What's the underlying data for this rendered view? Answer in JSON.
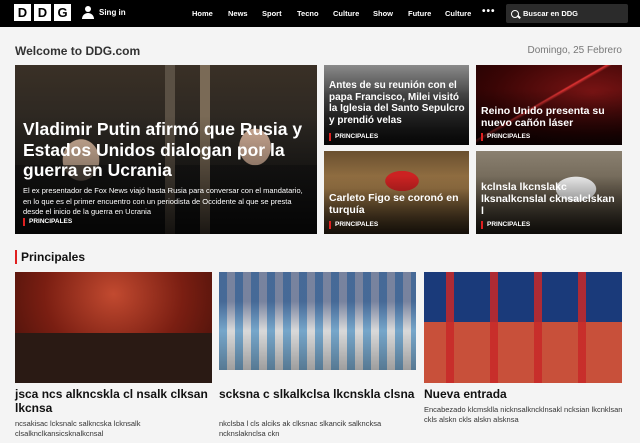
{
  "topbar": {
    "logo_letters": [
      "D",
      "D",
      "G"
    ],
    "signin_label": "Sing in",
    "nav": [
      "Home",
      "News",
      "Sport",
      "Tecno",
      "Culture",
      "Show",
      "Future",
      "Culture"
    ],
    "more_label": "•••",
    "search_placeholder": "Buscar en DDG"
  },
  "header": {
    "welcome": "Welcome to DDG.com",
    "date": "Domingo, 25 Febrero"
  },
  "hero": {
    "title": "Vladimir Putin afirmó que Rusia y Estados Unidos dialogan por la guerra en Ucrania",
    "description": "El ex presentador de Fox News viajó hasta Rusia para conversar con el mandatario, en lo que es el primer encuentro con un periodista de Occidente al que se presta desde el inicio de la guerra en Ucrania",
    "tag": "PRINCIPALES"
  },
  "tiles": [
    {
      "title": "Antes de su reunión con el papa Francisco, Milei visitó la Iglesia del Santo Sepulcro y prendió velas",
      "tag": "PRINCIPALES"
    },
    {
      "title": "Reino Unido presenta su nuevo cañón láser",
      "tag": "PRINCIPALES"
    },
    {
      "title": "Carleto Figo se coronó en turquía",
      "tag": "PRINCIPALES"
    },
    {
      "title": "kclnsla lkcnslakc lksnalkcnslal cknsalclskan l",
      "tag": "PRINCIPALES"
    }
  ],
  "principales": {
    "section_title": "Principales",
    "articles": [
      {
        "title": "jsca ncs alkncskla cl nsalk clksan lkcnsa",
        "desc": "ncsakisac lcksnalc salkncska lcknsalk clsalknclkansicsknalkcnsal"
      },
      {
        "title": "scksna c slkalkclsa lkcnskla clsna",
        "desc": "nkclsba l cls alciks ak clksnac slkancik salkncksa ncknslaknclsa ckn"
      },
      {
        "title": "Nueva entrada",
        "desc": "Encabezado klcmsklla nicknsalkncklnsakl ncksian lkcnklsan ckls alskn ckls alskn alsknsa"
      }
    ]
  }
}
